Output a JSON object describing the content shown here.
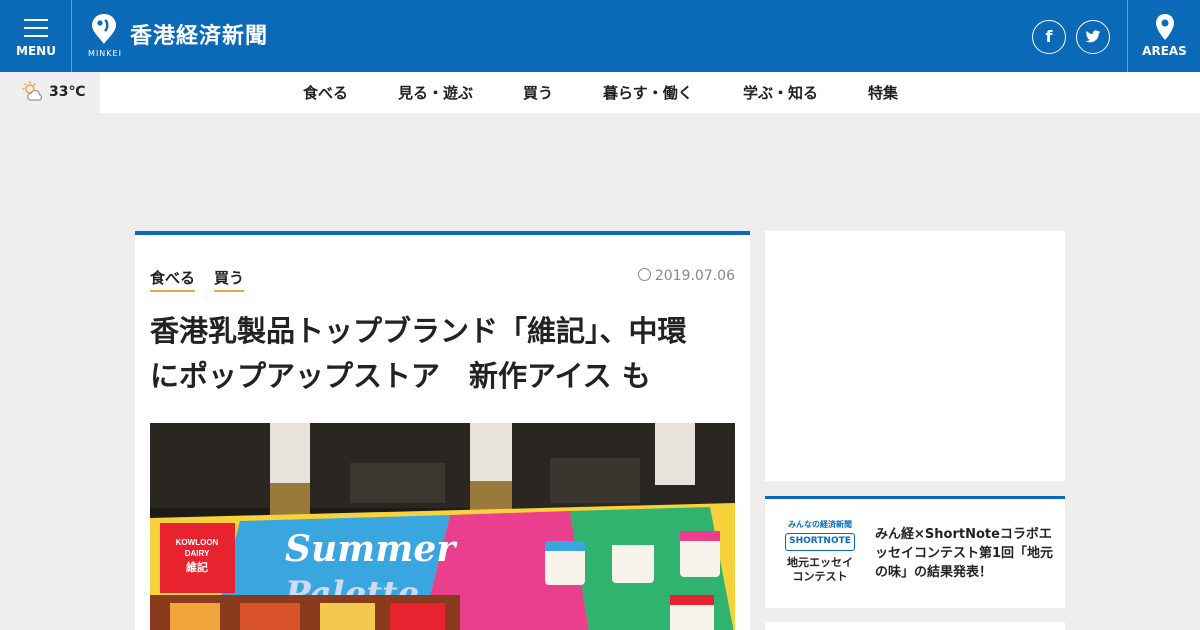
{
  "header": {
    "menu_label": "MENU",
    "logo_sub": "MINKEI",
    "site_name": "香港経済新聞",
    "facebook_glyph": "f",
    "areas_label": "AREAS",
    "brand_color": "#0a6ab8"
  },
  "weather": {
    "temperature": "33℃",
    "icon": "sun-cloud-icon"
  },
  "nav": {
    "items": [
      "食べる",
      "見る・遊ぶ",
      "買う",
      "暮らす・働く",
      "学ぶ・知る",
      "特集"
    ]
  },
  "article": {
    "categories": [
      "食べる",
      "買う"
    ],
    "date": "2019.07.06",
    "title_line1": "香港乳製品トップブランド「維記」、中環",
    "title_line2": "にポップアップストア　新作アイス も",
    "photo": {
      "brand_line1": "KOWLOON",
      "brand_line2": "DAIRY",
      "brand_line3": "維記",
      "sign_line1": "Summer",
      "sign_line2": "Palette"
    }
  },
  "sidebar": {
    "promo": {
      "logo_line1": "みんなの経済新聞",
      "logo_line2": "SHORTNOTE",
      "logo_line3a": "地元エッセイ",
      "logo_line3b": "コンテスト",
      "text": "みん経×ShortNoteコラボエッセイコンテスト第1回「地元の味」の結果発表！"
    }
  }
}
